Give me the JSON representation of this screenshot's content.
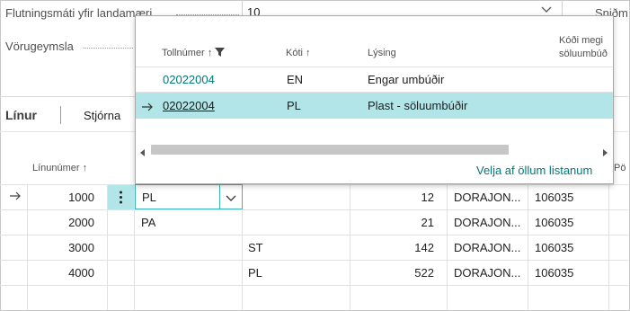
{
  "header_fields": {
    "transport_label": "Flutningsmáti yfir landamæri",
    "transport_value": "10",
    "right_label_partial": "Sniðm",
    "warehouse_label": "Vörugeymsla"
  },
  "lines_section": {
    "tab_lines": "Línur",
    "tab_manage": "Stjórna",
    "col_line_number": "Línunúmer",
    "col_right_partial": "Pö"
  },
  "rows": [
    {
      "line": "1000",
      "code": "PL",
      "col3": "",
      "qty": "12",
      "vendor": "DORAJON...",
      "no": "106035"
    },
    {
      "line": "2000",
      "code": "PA",
      "col3": "",
      "qty": "21",
      "vendor": "DORAJON...",
      "no": "106035"
    },
    {
      "line": "3000",
      "code": "",
      "col3": "ST",
      "qty": "142",
      "vendor": "DORAJON...",
      "no": "106035"
    },
    {
      "line": "4000",
      "code": "",
      "col3": "PL",
      "qty": "522",
      "vendor": "DORAJON...",
      "no": "106035"
    }
  ],
  "lookup": {
    "col_tariff": "Tollnúmer",
    "col_code": "Kóti",
    "col_description": "Lýsing",
    "col_sales_code_line1": "Kóði megi",
    "col_sales_code_line2": "söluumbúð",
    "rows": [
      {
        "tariff": "02022004",
        "code": "EN",
        "description": "Engar umbúðir"
      },
      {
        "tariff": "02022004",
        "code": "PL",
        "description": "Plast  - söluumbúðir"
      }
    ],
    "select_all_link": "Velja af öllum listanum"
  },
  "icons": {
    "sort_asc": "up-arrow-icon",
    "filter": "funnel-icon",
    "row_marker": "right-arrow-icon",
    "dropdown": "chevron-down-icon",
    "menu": "vertical-ellipsis-icon"
  },
  "colors": {
    "accent_teal": "#00787a",
    "selected_row": "#b2e5e8",
    "active_cell_border": "#3cb3b8"
  }
}
